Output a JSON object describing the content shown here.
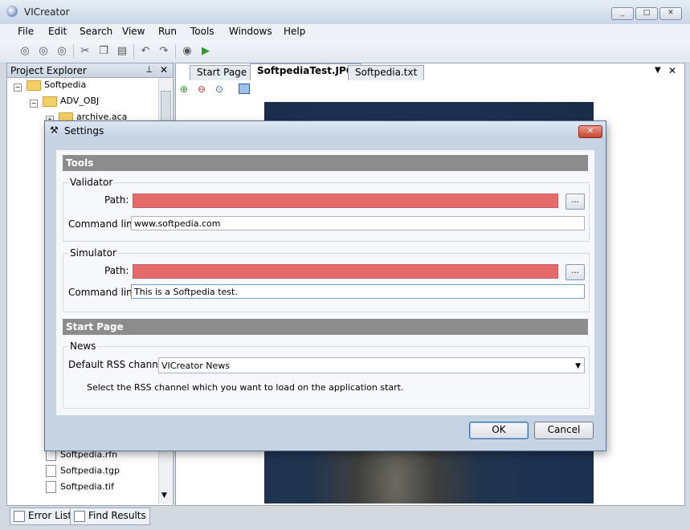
{
  "window": {
    "title": "VICreator",
    "controls": [
      "_",
      "□",
      "✕"
    ]
  },
  "menu": [
    "File",
    "Edit",
    "Search",
    "View",
    "Run",
    "Tools",
    "Windows",
    "Help"
  ],
  "explorer": {
    "title": "Project Explorer",
    "tree": [
      {
        "label": "Softpedia",
        "level": 0,
        "kind": "folder"
      },
      {
        "label": "ADV_OBJ",
        "level": 1,
        "kind": "folder"
      },
      {
        "label": "archive.aca",
        "level": 2,
        "kind": "file"
      }
    ],
    "bottom_files": [
      "Softpedia.rfn",
      "Softpedia.tgp",
      "Softpedia.tif"
    ]
  },
  "bottom_tabs": [
    "Error List",
    "Find Results"
  ],
  "doc_tabs": [
    "Start Page",
    "SoftpediaTest.JPG",
    "Softpedia.txt"
  ],
  "dialog": {
    "title": "Settings",
    "close": "✕",
    "tools_header": "Tools",
    "validator": {
      "group": "Validator",
      "path_label": "Path:",
      "path_value": "",
      "browse": "...",
      "cmd_label": "Command line:",
      "cmd_value": "www.softpedia.com"
    },
    "simulator": {
      "group": "Simulator",
      "path_label": "Path:",
      "path_value": "",
      "browse": "...",
      "cmd_label": "Command line:",
      "cmd_value": "This is a Softpedia test."
    },
    "start_header": "Start Page",
    "news": {
      "group": "News",
      "rss_label": "Default RSS channel:",
      "rss_value": "VICreator News",
      "hint": "Select the RSS channel which you want to load on the application start."
    },
    "ok": "OK",
    "cancel": "Cancel"
  }
}
